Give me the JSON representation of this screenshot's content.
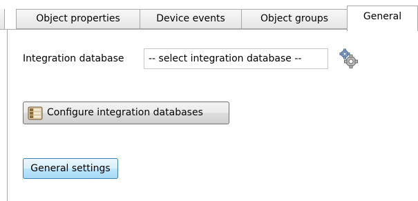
{
  "tabs": [
    {
      "label": "Object properties",
      "active": false
    },
    {
      "label": "Device events",
      "active": false
    },
    {
      "label": "Object groups",
      "active": false
    },
    {
      "label": "General",
      "active": true
    }
  ],
  "integration": {
    "label": "Integration database",
    "selected_value": "-- select integration database --",
    "settings_icon": "gears-icon"
  },
  "buttons": {
    "configure_label": "Configure integration databases",
    "configure_icon": "database-config-icon",
    "general_settings_label": "General settings"
  },
  "colors": {
    "accent_button_border": "#3c7fb1",
    "tab_border": "#a9a9a9"
  }
}
